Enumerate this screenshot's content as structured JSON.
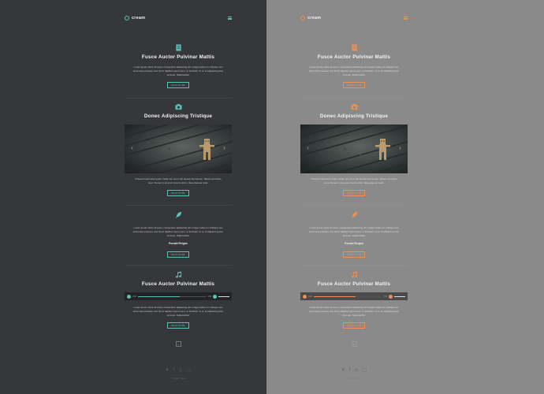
{
  "themes": [
    {
      "name": "dark",
      "accent": "#5bc2b6"
    },
    {
      "name": "grey",
      "accent": "#f08f52"
    }
  ],
  "brand": {
    "name": "cream"
  },
  "icons": {
    "logo": "cream-logo-icon",
    "menu": "hamburger-menu-icon",
    "article": "document-icon",
    "gallery": "camera-icon",
    "quote": "feather-icon",
    "audio": "music-note-icon"
  },
  "posts": {
    "article": {
      "title": "Fusce Auctor  Pulvinar Mattis",
      "text": "Lorem ipsum dolor sit amet, consectetur adipiscing elit. Integer tellus mi, tristique nec accumsan posuere nisl, Nunc dapibus ipsum sem, ut tincidunt mi ut, id adipiscing arcu sit amet. Nulla facilisi.",
      "button": "READ MORE"
    },
    "gallery": {
      "title": "Donec Adipiscing Tristique",
      "text": "Praesent quis lacus justo. Nulla nec est ut dui laoreet fermentum. Mauris ac luctus nunc. Donec in sit amet viverra tortor, vitae placerat nulla.",
      "button": "READ MORE"
    },
    "quote": {
      "text": "Lorem ipsum dolor sit amet, consectetur adipiscing elit. Integer tellus mi, tristique nec accumsan posuere nisl, Nunc dapibus ipsum sem, ut tincidunt mi ut, id adipiscing arcu sit amet. Nulla facilisi.",
      "author": "Ronald Reigan",
      "button": "READ MORE"
    },
    "audio": {
      "title": "Fusce Auctor  Pulvinar Mattis",
      "elapsed": "0:00",
      "duration": "3:42",
      "progress": 0.62,
      "text": "Lorem ipsum dolor sit amet, consectetur adipiscing elit. Integer tellus mi, tristique nec accumsan posuere nisl, Nunc dapibus ipsum sem, ut tincidunt mi ut, id adipiscing arcu sit amet. Nulla facilisi.",
      "button": "READ MORE"
    }
  },
  "pagination": {
    "current": "1"
  },
  "social": [
    "twitter-icon",
    "facebook-icon",
    "instagram-icon",
    "chat-icon"
  ],
  "social_glyphs": {
    "twitter": "❦",
    "facebook": "f",
    "instagram": "◎",
    "chat": "▢"
  },
  "footer": {
    "copyright": "© Cream Theme"
  }
}
